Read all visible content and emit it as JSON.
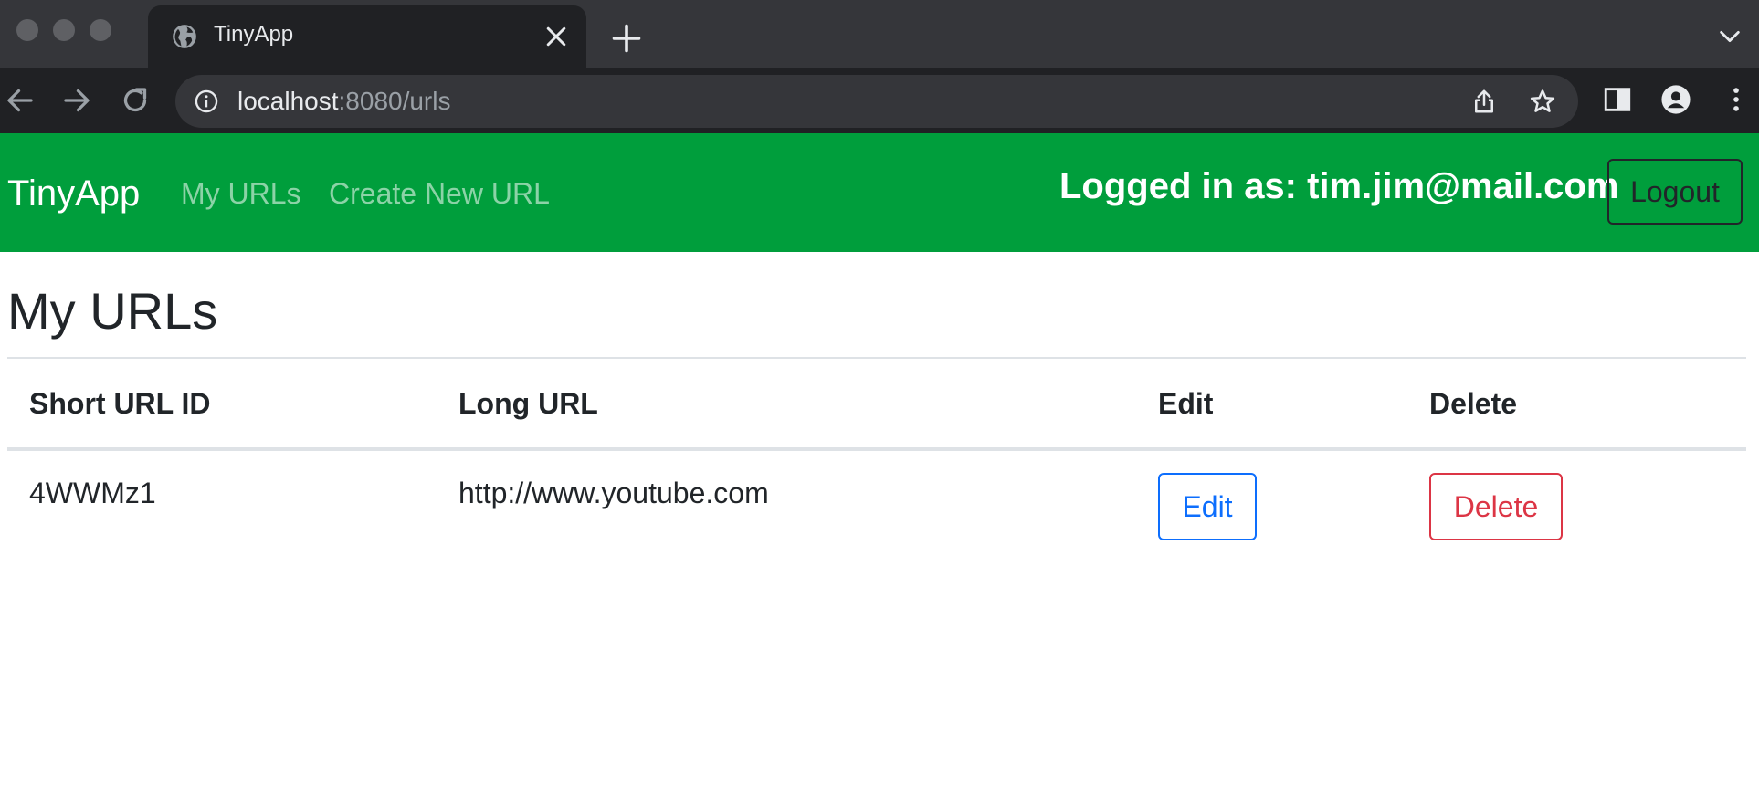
{
  "browser": {
    "tab_title": "TinyApp",
    "url_host": "localhost",
    "url_rest": ":8080/urls"
  },
  "navbar": {
    "brand": "TinyApp",
    "links": [
      "My URLs",
      "Create New URL"
    ],
    "logged_in_text": "Logged in as: tim.jim@mail.com",
    "logout_label": "Logout",
    "background_color": "#009e3c"
  },
  "main": {
    "title": "My URLs",
    "table": {
      "headers": [
        "Short URL ID",
        "Long URL",
        "Edit",
        "Delete"
      ],
      "rows": [
        {
          "short_id": "4WWMz1",
          "long_url": "http://www.youtube.com",
          "edit_label": "Edit",
          "delete_label": "Delete"
        }
      ]
    }
  },
  "colors": {
    "edit_accent": "#0d6efd",
    "delete_accent": "#dc3545"
  },
  "icons": [
    "globe-icon",
    "close-icon",
    "plus-icon",
    "chevron-down-icon",
    "back-arrow-icon",
    "forward-arrow-icon",
    "reload-icon",
    "info-icon",
    "share-icon",
    "star-icon",
    "side-panel-icon",
    "profile-icon",
    "kebab-menu-icon"
  ]
}
